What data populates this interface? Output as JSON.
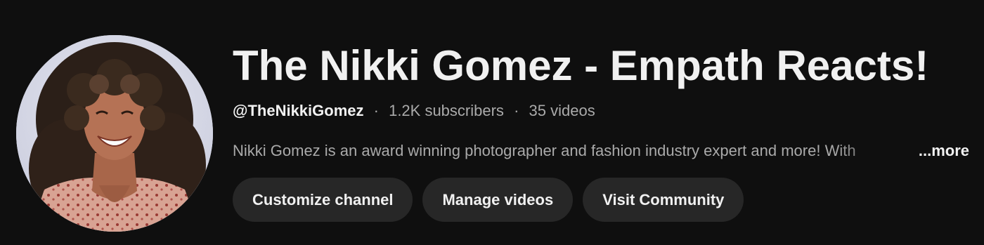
{
  "channel": {
    "name": "The Nikki Gomez - Empath Reacts!",
    "handle": "@TheNikkiGomez",
    "subscribers": "1.2K subscribers",
    "videos": "35 videos",
    "separator": "·",
    "description": "Nikki Gomez is an award winning photographer and fashion industry expert and more! With",
    "more_label": "...more"
  },
  "actions": {
    "customize_label": "Customize channel",
    "manage_label": "Manage videos",
    "community_label": "Visit Community"
  },
  "colors": {
    "background": "#0f0f0f",
    "primary_text": "#f1f1f1",
    "secondary_text": "#aaaaaa",
    "button_background": "#272727"
  }
}
